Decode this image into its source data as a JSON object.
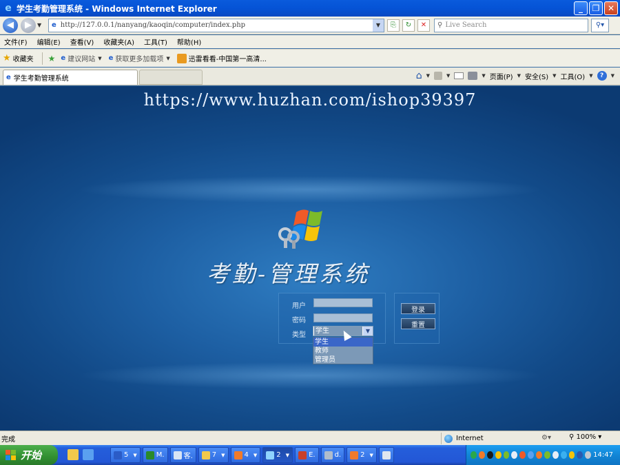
{
  "window": {
    "title": "学生考勤管理系统 - Windows Internet Explorer"
  },
  "nav": {
    "url": "http://127.0.0.1/nanyang/kaoqin/computer/index.php",
    "search_placeholder": "Live Search"
  },
  "menu": [
    "文件(F)",
    "编辑(E)",
    "查看(V)",
    "收藏夹(A)",
    "工具(T)",
    "帮助(H)"
  ],
  "favorites": {
    "label": "收藏夹",
    "items": [
      "建议网站",
      "获取更多加载项",
      "迅雷看看-中国第一高清..."
    ]
  },
  "tab": {
    "title": "学生考勤管理系统"
  },
  "commands": {
    "page": "页面(P)",
    "safety": "安全(S)",
    "tools": "工具(O)"
  },
  "content": {
    "watermark": "https://www.huzhan.com/ishop39397",
    "logo_title": "考勤-管理系统",
    "form": {
      "user_label": "用户",
      "password_label": "密码",
      "type_label": "类型",
      "user_value": "",
      "password_value": "",
      "type_selected": "学生",
      "type_options": [
        "学生",
        "教师",
        "管理员"
      ]
    },
    "buttons": {
      "login": "登录",
      "reset": "重置"
    }
  },
  "status": {
    "text": "完成",
    "zone": "Internet",
    "zoom": "100%"
  },
  "taskbar": {
    "start": "开始",
    "tasks": [
      "5",
      "M.",
      "客.",
      "7",
      "4",
      "2",
      "E.",
      "d.",
      "2"
    ],
    "clock": "14:47"
  },
  "colors": {
    "background_blue": "#124a88",
    "highlight": "#3a66c8"
  }
}
